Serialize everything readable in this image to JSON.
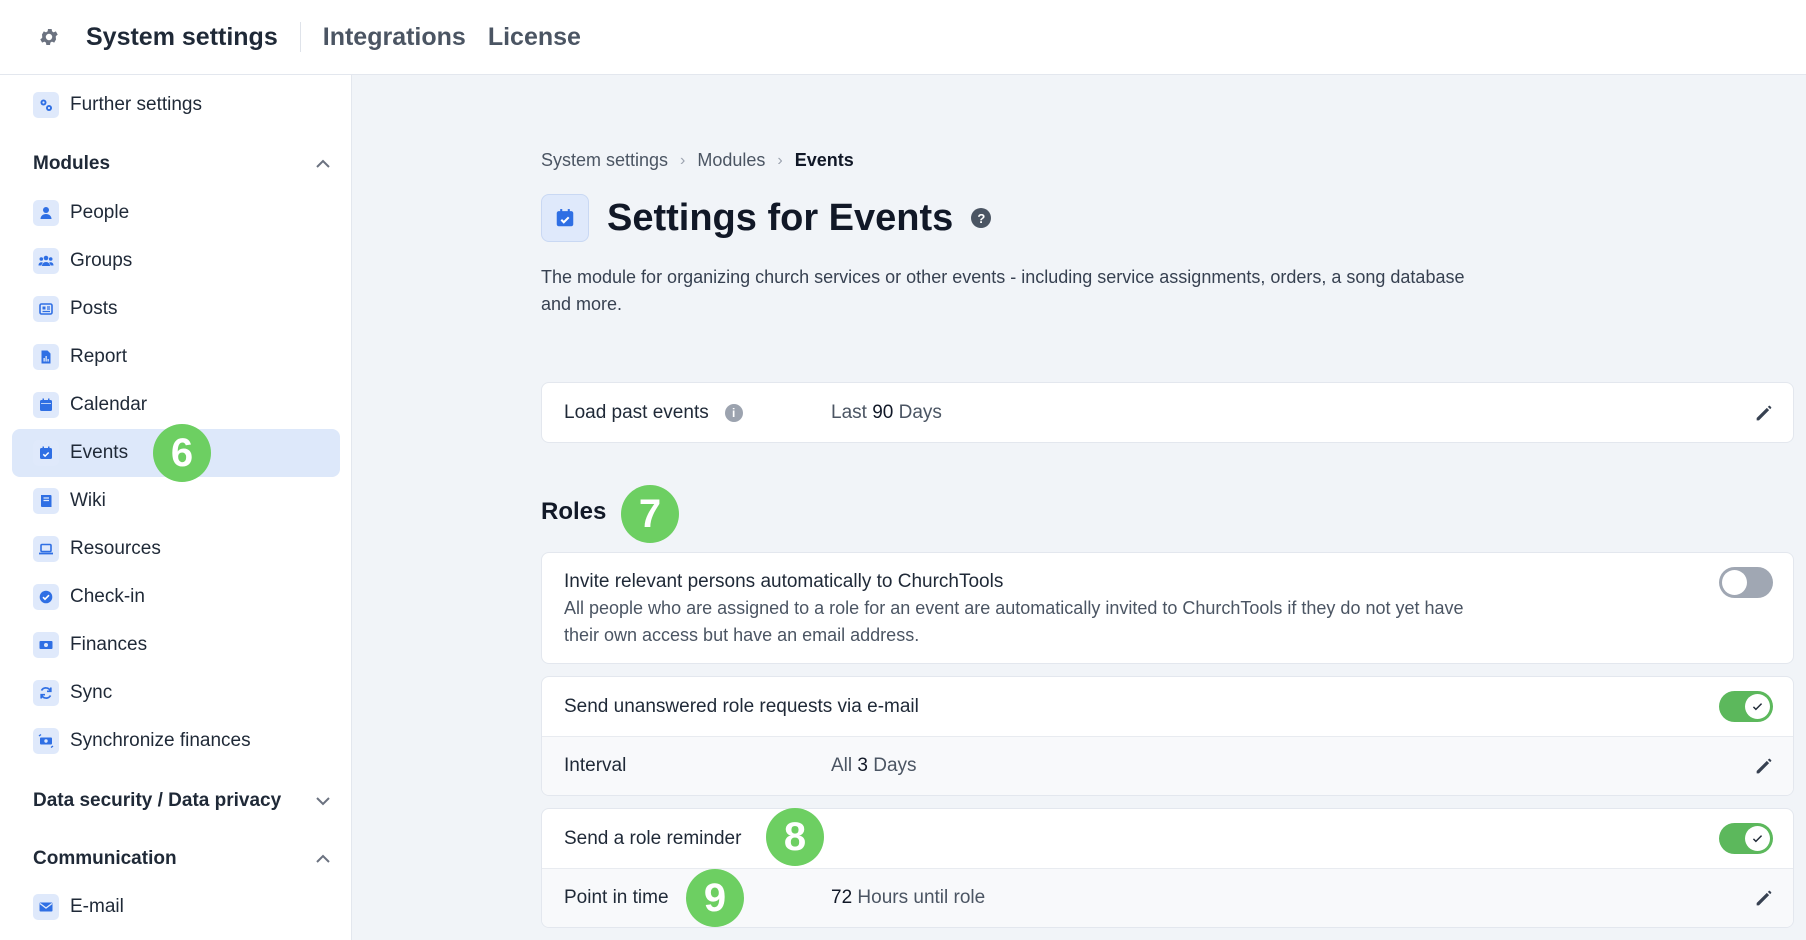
{
  "topbar": {
    "title": "System settings",
    "links": [
      "Integrations",
      "License"
    ]
  },
  "sidebar": {
    "further_settings": "Further settings",
    "modules_header": "Modules",
    "items": [
      {
        "label": "People",
        "icon": "person-icon"
      },
      {
        "label": "Groups",
        "icon": "group-icon"
      },
      {
        "label": "Posts",
        "icon": "newspaper-icon"
      },
      {
        "label": "Report",
        "icon": "report-icon"
      },
      {
        "label": "Calendar",
        "icon": "calendar-icon"
      },
      {
        "label": "Events",
        "icon": "calendar-check-icon",
        "active": true
      },
      {
        "label": "Wiki",
        "icon": "book-icon"
      },
      {
        "label": "Resources",
        "icon": "laptop-icon"
      },
      {
        "label": "Check-in",
        "icon": "check-circle-icon"
      },
      {
        "label": "Finances",
        "icon": "money-icon"
      },
      {
        "label": "Sync",
        "icon": "sync-icon"
      },
      {
        "label": "Synchronize finances",
        "icon": "money-sync-icon"
      }
    ],
    "data_security_header": "Data security / Data privacy",
    "communication_header": "Communication",
    "email_item": "E-mail"
  },
  "breadcrumb": [
    "System settings",
    "Modules",
    "Events"
  ],
  "page": {
    "title": "Settings for Events",
    "description": "The module for organizing church services or other events - including service assignments, orders, a song database and more."
  },
  "load_past": {
    "label": "Load past events",
    "prefix": "Last",
    "value": "90",
    "suffix": "Days"
  },
  "roles": {
    "title": "Roles",
    "invite": {
      "label": "Invite relevant persons automatically to ChurchTools",
      "description": "All people who are assigned to a role for an event are automatically invited to ChurchTools if they do not yet have their own access but have an email address.",
      "enabled": false
    },
    "unanswered": {
      "label": "Send unanswered role requests via e-mail",
      "enabled": true,
      "interval_label": "Interval",
      "interval_prefix": "All",
      "interval_value": "3",
      "interval_suffix": "Days"
    },
    "reminder": {
      "label": "Send a role reminder",
      "enabled": true,
      "point_label": "Point in time",
      "point_value": "72",
      "point_suffix": "Hours until role"
    }
  },
  "badges": [
    "6",
    "7",
    "8",
    "9"
  ],
  "colors": {
    "accent": "#2f6fe4",
    "badge": "#6dcf62",
    "toggle_on": "#5cb85c",
    "toggle_off": "#a0a7b3",
    "active_bg": "#dde8fa"
  }
}
